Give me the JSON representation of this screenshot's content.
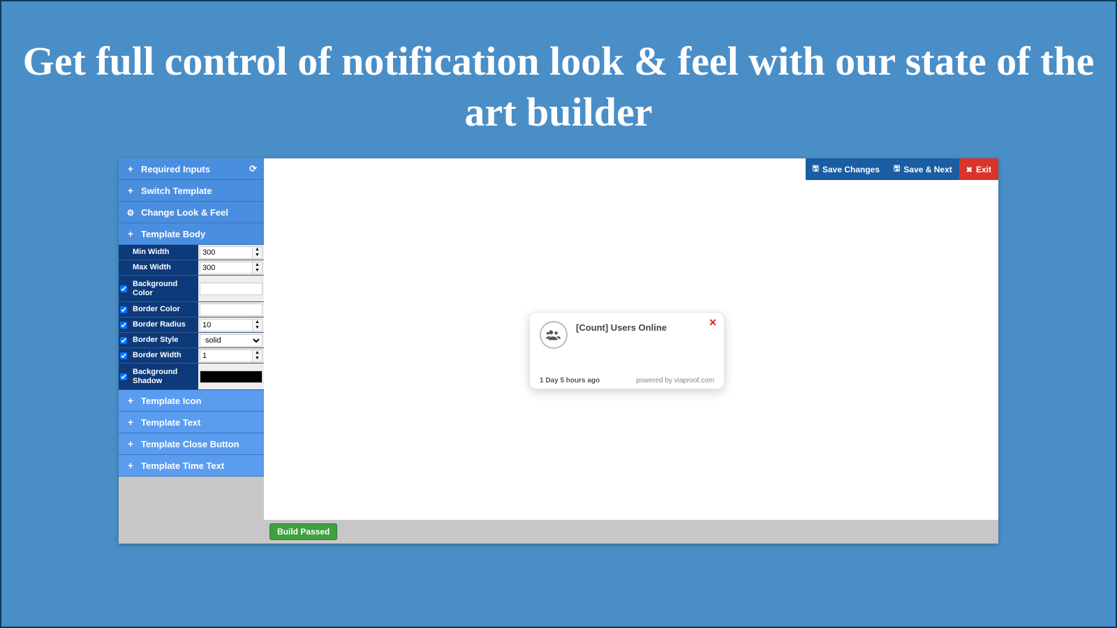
{
  "headline": "Get full control of notification look & feel with our state of the art builder",
  "sidebar": {
    "required_inputs": "Required Inputs",
    "switch_template": "Switch Template",
    "change_look_feel": "Change Look & Feel",
    "template_body": "Template Body",
    "template_icon": "Template Icon",
    "template_text": "Template Text",
    "template_close_button": "Template Close Button",
    "template_time_text": "Template Time Text"
  },
  "props": {
    "min_width": {
      "label": "Min Width",
      "value": "300"
    },
    "max_width": {
      "label": "Max Width",
      "value": "300"
    },
    "background_color": {
      "label": "Background Color"
    },
    "border_color": {
      "label": "Border Color"
    },
    "border_radius": {
      "label": "Border Radius",
      "value": "10"
    },
    "border_style": {
      "label": "Border Style",
      "value": "solid"
    },
    "border_width": {
      "label": "Border Width",
      "value": "1"
    },
    "background_shadow": {
      "label": "Background Shadow"
    }
  },
  "toolbar": {
    "save_changes": "Save Changes",
    "save_next": "Save & Next",
    "exit": "Exit"
  },
  "notification": {
    "title": "[Count] Users Online",
    "time": "1 Day 5 hours ago",
    "powered": "powered by viaproof.com"
  },
  "status": {
    "build": "Build Passed"
  }
}
